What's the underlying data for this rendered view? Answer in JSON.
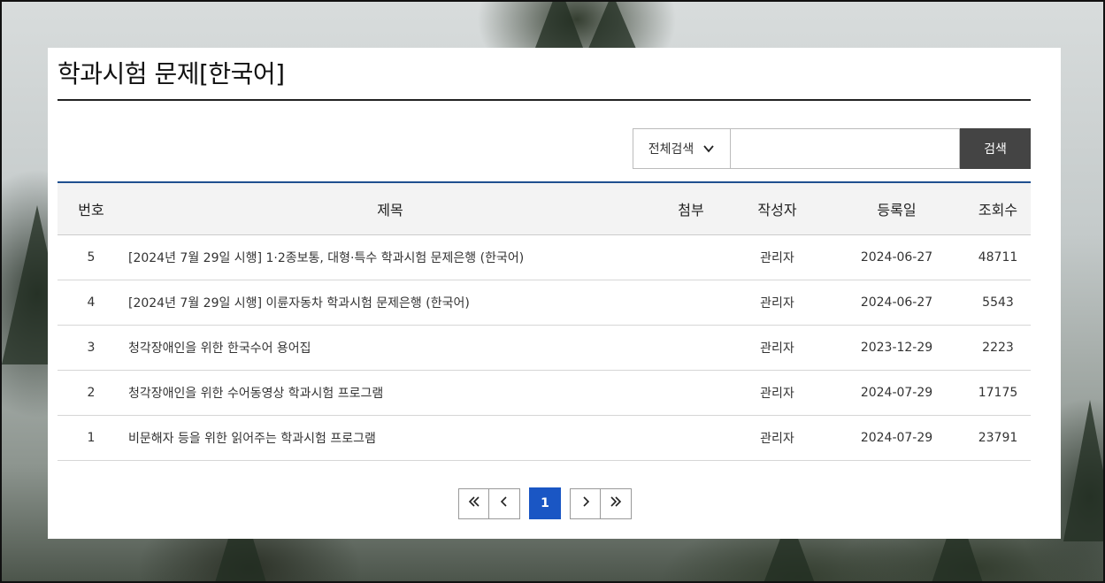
{
  "page": {
    "title": "학과시험 문제[한국어]"
  },
  "search": {
    "scope_label": "전체검색",
    "query_value": "",
    "button_label": "검색"
  },
  "table": {
    "headers": {
      "no": "번호",
      "subject": "제목",
      "attach": "첨부",
      "writer": "작성자",
      "date": "등록일",
      "views": "조회수"
    },
    "rows": [
      {
        "no": "5",
        "subject": "[2024년 7월 29일 시행] 1·2종보통, 대형·특수 학과시험 문제은행 (한국어)",
        "attach": "",
        "writer": "관리자",
        "date": "2024-06-27",
        "views": "48711"
      },
      {
        "no": "4",
        "subject": "[2024년 7월 29일 시행] 이륜자동차 학과시험 문제은행 (한국어)",
        "attach": "",
        "writer": "관리자",
        "date": "2024-06-27",
        "views": "5543"
      },
      {
        "no": "3",
        "subject": "청각장애인을 위한 한국수어 용어집",
        "attach": "",
        "writer": "관리자",
        "date": "2023-12-29",
        "views": "2223"
      },
      {
        "no": "2",
        "subject": "청각장애인을 위한 수어동영상 학과시험 프로그램",
        "attach": "",
        "writer": "관리자",
        "date": "2024-07-29",
        "views": "17175"
      },
      {
        "no": "1",
        "subject": "비문해자 등을 위한 읽어주는 학과시험 프로그램",
        "attach": "",
        "writer": "관리자",
        "date": "2024-07-29",
        "views": "23791"
      }
    ]
  },
  "pagination": {
    "current_page": "1",
    "icons": [
      "first-page-icon",
      "prev-page-icon",
      "next-page-icon",
      "last-page-icon"
    ],
    "active_color": "#1a56c4"
  },
  "colors": {
    "table_top_border": "#1f4f8f",
    "search_button_bg": "#444444"
  }
}
